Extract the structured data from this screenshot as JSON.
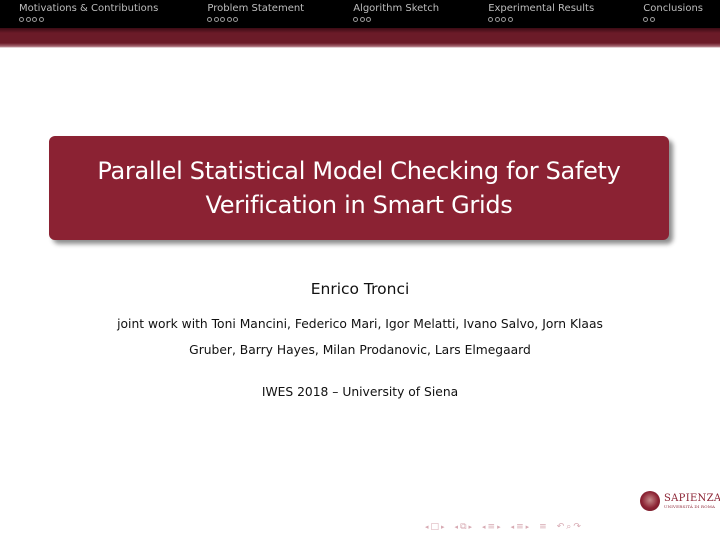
{
  "headline": {
    "sections": [
      {
        "label": "Motivations & Contributions",
        "slides": 4
      },
      {
        "label": "Problem Statement",
        "slides": 5
      },
      {
        "label": "Algorithm Sketch",
        "slides": 3
      },
      {
        "label": "Experimental Results",
        "slides": 4
      },
      {
        "label": "Conclusions",
        "slides": 2
      }
    ]
  },
  "title": {
    "line1": "Parallel Statistical Model Checking for Safety",
    "line2": "Verification in Smart Grids"
  },
  "author": "Enrico Tronci",
  "coauthors": {
    "line1": "joint work with Toni Mancini, Federico Mari, Igor Melatti, Ivano Salvo, Jorn Klaas",
    "line2": "Gruber, Barry Hayes, Milan Prodanovic, Lars Elmegaard"
  },
  "event": "IWES 2018 – University of Siena",
  "logo": {
    "name": "SAPIENZA",
    "subtitle": "UNIVERSITÀ DI ROMA"
  },
  "navigation": {
    "frame_symbol": "□",
    "subsection_symbol": "⧉",
    "section_symbol": "≡",
    "subsection_list_symbol": "≡",
    "toc_symbol": "≡",
    "back_symbol": "↶",
    "search_symbol": "⌕",
    "forward_symbol": "↷",
    "left_arrow": "◂",
    "right_arrow": "▸"
  },
  "colors": {
    "accent": "#8b2233",
    "headline_bg": "#000000",
    "band": "#6b1b28",
    "nav": "#d7a9b2"
  }
}
